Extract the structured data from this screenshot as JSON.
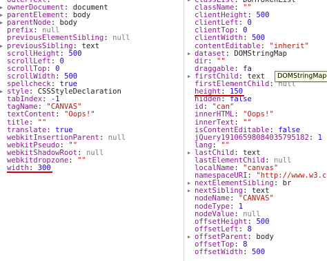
{
  "left_props": [
    {
      "expandable": false,
      "key": "outerText",
      "type": "string",
      "value": "\"\""
    },
    {
      "expandable": true,
      "key": "ownerDocument",
      "type": "object",
      "value": "document"
    },
    {
      "expandable": true,
      "key": "parentElement",
      "type": "object",
      "value": "body"
    },
    {
      "expandable": true,
      "key": "parentNode",
      "type": "object",
      "value": "body"
    },
    {
      "expandable": false,
      "key": "prefix",
      "type": "null",
      "value": "null"
    },
    {
      "expandable": false,
      "key": "previousElementSibling",
      "type": "null",
      "value": "null"
    },
    {
      "expandable": true,
      "key": "previousSibling",
      "type": "object",
      "value": "text"
    },
    {
      "expandable": false,
      "key": "scrollHeight",
      "type": "number",
      "value": "500"
    },
    {
      "expandable": false,
      "key": "scrollLeft",
      "type": "number",
      "value": "0"
    },
    {
      "expandable": false,
      "key": "scrollTop",
      "type": "number",
      "value": "0"
    },
    {
      "expandable": false,
      "key": "scrollWidth",
      "type": "number",
      "value": "500"
    },
    {
      "expandable": false,
      "key": "spellcheck",
      "type": "bool",
      "value": "true"
    },
    {
      "expandable": true,
      "key": "style",
      "type": "object",
      "value": "CSSStyleDeclaration"
    },
    {
      "expandable": false,
      "key": "tabIndex",
      "type": "number",
      "value": "-1"
    },
    {
      "expandable": false,
      "key": "tagName",
      "type": "string",
      "value": "\"CANVAS\""
    },
    {
      "expandable": false,
      "key": "textContent",
      "type": "string",
      "value": "\"Oops!\""
    },
    {
      "expandable": false,
      "key": "title",
      "type": "string",
      "value": "\"\""
    },
    {
      "expandable": false,
      "key": "translate",
      "type": "bool",
      "value": "true"
    },
    {
      "expandable": false,
      "key": "webkitInsertionParent",
      "type": "null",
      "value": "null"
    },
    {
      "expandable": false,
      "key": "webkitPseudo",
      "type": "string",
      "value": "\"\""
    },
    {
      "expandable": false,
      "key": "webkitShadowRoot",
      "type": "null",
      "value": "null"
    },
    {
      "expandable": false,
      "key": "webkitdropzone",
      "type": "string",
      "value": "\"\""
    },
    {
      "expandable": false,
      "key": "width",
      "type": "number",
      "value": "300",
      "highlight": true
    }
  ],
  "right_props": [
    {
      "expandable": true,
      "key": "classList",
      "type": "object",
      "value": "DOMTokenList"
    },
    {
      "expandable": false,
      "key": "className",
      "type": "string",
      "value": "\"\""
    },
    {
      "expandable": false,
      "key": "clientHeight",
      "type": "number",
      "value": "500"
    },
    {
      "expandable": false,
      "key": "clientLeft",
      "type": "number",
      "value": "0"
    },
    {
      "expandable": false,
      "key": "clientTop",
      "type": "number",
      "value": "0"
    },
    {
      "expandable": false,
      "key": "clientWidth",
      "type": "number",
      "value": "500"
    },
    {
      "expandable": false,
      "key": "contentEditable",
      "type": "string",
      "value": "\"inherit\""
    },
    {
      "expandable": true,
      "key": "dataset",
      "type": "object",
      "value": "DOMStringMap"
    },
    {
      "expandable": false,
      "key": "dir",
      "type": "string",
      "value": "\"\""
    },
    {
      "expandable": false,
      "key": "draggable",
      "type": "bool",
      "value": "fa"
    },
    {
      "expandable": true,
      "key": "firstChild",
      "type": "object",
      "value": "text"
    },
    {
      "expandable": false,
      "key": "firstElementChild",
      "type": "null",
      "value": "null"
    },
    {
      "expandable": false,
      "key": "height",
      "type": "number",
      "value": "150",
      "highlight": true
    },
    {
      "expandable": false,
      "key": "hidden",
      "type": "bool",
      "value": "false"
    },
    {
      "expandable": false,
      "key": "id",
      "type": "string",
      "value": "\"can\""
    },
    {
      "expandable": false,
      "key": "innerHTML",
      "type": "string",
      "value": "\"Oops!\""
    },
    {
      "expandable": false,
      "key": "innerText",
      "type": "string",
      "value": "\"\""
    },
    {
      "expandable": false,
      "key": "isContentEditable",
      "type": "bool",
      "value": "false"
    },
    {
      "expandable": false,
      "key": "jQuery19106598084035795182",
      "type": "number",
      "value": "1"
    },
    {
      "expandable": false,
      "key": "lang",
      "type": "string",
      "value": "\"\""
    },
    {
      "expandable": true,
      "key": "lastChild",
      "type": "object",
      "value": "text"
    },
    {
      "expandable": false,
      "key": "lastElementChild",
      "type": "null",
      "value": "null"
    },
    {
      "expandable": false,
      "key": "localName",
      "type": "string",
      "value": "\"canvas\""
    },
    {
      "expandable": false,
      "key": "namespaceURI",
      "type": "string",
      "value": "\"http://www.w3.c"
    },
    {
      "expandable": true,
      "key": "nextElementSibling",
      "type": "object",
      "value": "br"
    },
    {
      "expandable": true,
      "key": "nextSibling",
      "type": "object",
      "value": "text"
    },
    {
      "expandable": false,
      "key": "nodeName",
      "type": "string",
      "value": "\"CANVAS\""
    },
    {
      "expandable": false,
      "key": "nodeType",
      "type": "number",
      "value": "1"
    },
    {
      "expandable": false,
      "key": "nodeValue",
      "type": "null",
      "value": "null"
    },
    {
      "expandable": false,
      "key": "offsetHeight",
      "type": "number",
      "value": "500"
    },
    {
      "expandable": false,
      "key": "offsetLeft",
      "type": "number",
      "value": "8"
    },
    {
      "expandable": true,
      "key": "offsetParent",
      "type": "object",
      "value": "body"
    },
    {
      "expandable": false,
      "key": "offsetTop",
      "type": "number",
      "value": "8"
    },
    {
      "expandable": false,
      "key": "offsetWidth",
      "type": "number",
      "value": "500"
    }
  ],
  "tooltip": "DOMStringMap",
  "colors": {
    "key": "#8a1a8e",
    "string": "#b01a10",
    "number": "#1c00cf",
    "null": "#808080",
    "highlight_underline": "#cc0000"
  }
}
